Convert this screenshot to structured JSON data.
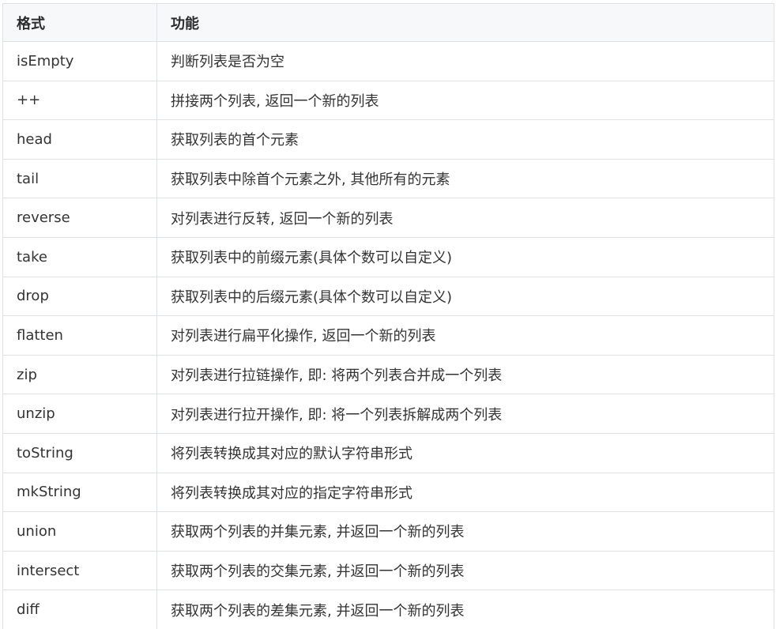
{
  "table": {
    "headers": [
      "格式",
      "功能"
    ],
    "rows": [
      [
        "isEmpty",
        "判断列表是否为空"
      ],
      [
        "++",
        "拼接两个列表, 返回一个新的列表"
      ],
      [
        "head",
        "获取列表的首个元素"
      ],
      [
        "tail",
        "获取列表中除首个元素之外, 其他所有的元素"
      ],
      [
        "reverse",
        "对列表进行反转, 返回一个新的列表"
      ],
      [
        "take",
        "获取列表中的前缀元素(具体个数可以自定义)"
      ],
      [
        "drop",
        "获取列表中的后缀元素(具体个数可以自定义)"
      ],
      [
        "flatten",
        "对列表进行扁平化操作, 返回一个新的列表"
      ],
      [
        "zip",
        "对列表进行拉链操作, 即: 将两个列表合并成一个列表"
      ],
      [
        "unzip",
        "对列表进行拉开操作, 即: 将一个列表拆解成两个列表"
      ],
      [
        "toString",
        "将列表转换成其对应的默认字符串形式"
      ],
      [
        "mkString",
        "将列表转换成其对应的指定字符串形式"
      ],
      [
        "union",
        "获取两个列表的并集元素, 并返回一个新的列表"
      ],
      [
        "intersect",
        "获取两个列表的交集元素, 并返回一个新的列表"
      ],
      [
        "diff",
        "获取两个列表的差集元素, 并返回一个新的列表"
      ]
    ]
  }
}
